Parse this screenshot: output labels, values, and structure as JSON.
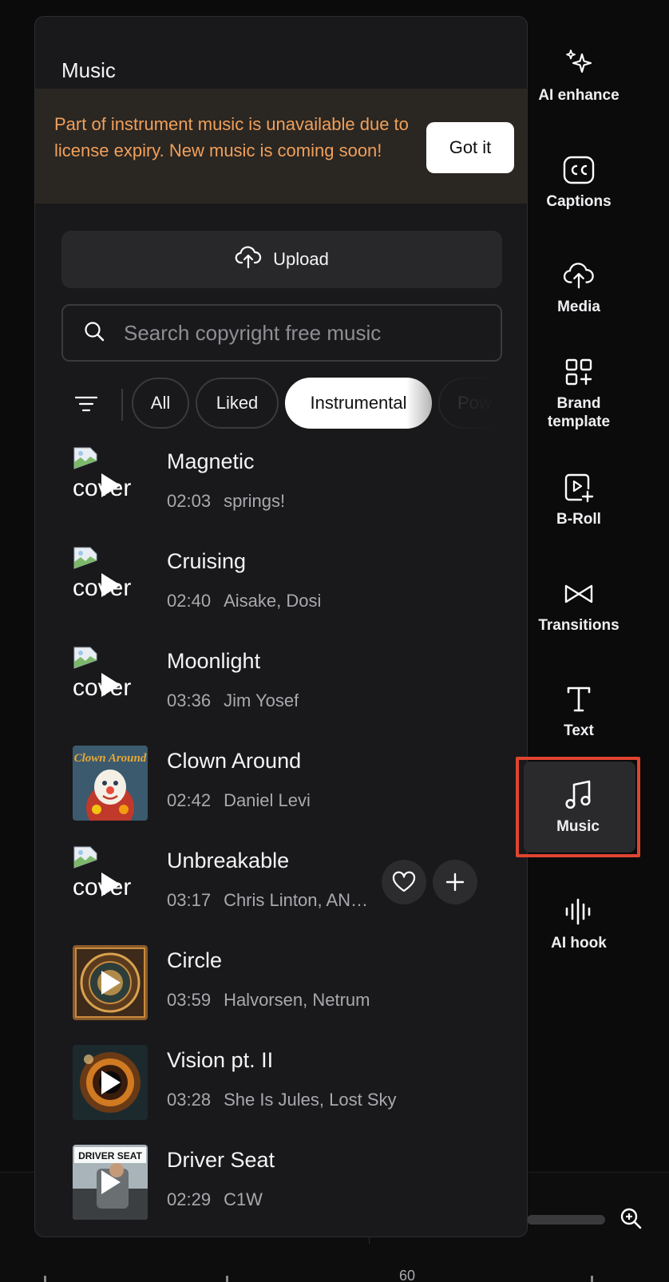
{
  "panel": {
    "title": "Music",
    "notice": {
      "text": "Part of instrument music is unavailable due to license expiry. New music is coming soon!",
      "button": "Got it"
    },
    "upload_label": "Upload",
    "search_placeholder": "Search copyright free music",
    "filters": [
      {
        "label": "All",
        "active": false
      },
      {
        "label": "Liked",
        "active": false
      },
      {
        "label": "Instrumental",
        "active": true
      },
      {
        "label": "Pow",
        "active": false
      }
    ],
    "tracks": [
      {
        "title": "Magnetic",
        "duration": "02:03",
        "artist": "springs!",
        "cover": "broken",
        "cover_alt": "cover"
      },
      {
        "title": "Cruising",
        "duration": "02:40",
        "artist": "Aisake, Dosi",
        "cover": "broken",
        "cover_alt": "cover"
      },
      {
        "title": "Moonlight",
        "duration": "03:36",
        "artist": "Jim Yosef",
        "cover": "broken",
        "cover_alt": "cover"
      },
      {
        "title": "Clown Around",
        "duration": "02:42",
        "artist": "Daniel Levi",
        "cover": "art",
        "cover_text": "Clown Around"
      },
      {
        "title": "Unbreakable",
        "duration": "03:17",
        "artist": "Chris Linton, AN…",
        "cover": "broken",
        "cover_alt": "cover",
        "hovered": true
      },
      {
        "title": "Circle",
        "duration": "03:59",
        "artist": "Halvorsen, Netrum",
        "cover": "art"
      },
      {
        "title": "Vision pt. II",
        "duration": "03:28",
        "artist": "She Is Jules, Lost Sky",
        "cover": "art"
      },
      {
        "title": "Driver Seat",
        "duration": "02:29",
        "artist": "C1W",
        "cover": "art",
        "cover_text": "DRIVER SEAT"
      }
    ]
  },
  "rail": [
    {
      "label": "AI enhance",
      "icon": "sparkles-icon"
    },
    {
      "label": "Captions",
      "icon": "cc-icon"
    },
    {
      "label": "Media",
      "icon": "cloud-upload-icon"
    },
    {
      "label": "Brand\ntemplate",
      "icon": "grid-plus-icon"
    },
    {
      "label": "B-Roll",
      "icon": "video-plus-icon"
    },
    {
      "label": "Transitions",
      "icon": "transition-icon"
    },
    {
      "label": "Text",
      "icon": "text-icon"
    },
    {
      "label": "Music",
      "icon": "music-note-icon",
      "selected": true
    },
    {
      "label": "AI hook",
      "icon": "waveform-icon"
    }
  ],
  "timeline": {
    "ruler_label": "60"
  },
  "colors": {
    "accent_notice": "#f0a05a",
    "selection_border": "#e0442f"
  }
}
